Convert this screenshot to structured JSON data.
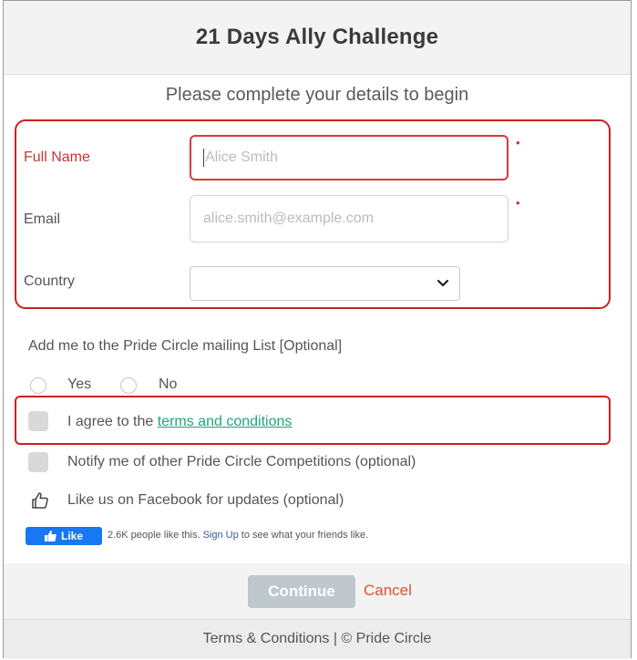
{
  "header": {
    "title": "21 Days Ally Challenge"
  },
  "form": {
    "subtitle": "Please complete your details to begin",
    "full_name": {
      "label": "Full Name",
      "placeholder": "Alice Smith",
      "required_mark": "•"
    },
    "email": {
      "label": "Email",
      "placeholder": "alice.smith@example.com",
      "required_mark": "•"
    },
    "country": {
      "label": "Country",
      "value": ""
    }
  },
  "mailing_list": {
    "question": "Add me to the Pride Circle mailing List [Optional]",
    "options": [
      {
        "label": "Yes"
      },
      {
        "label": "No"
      }
    ]
  },
  "terms": {
    "prefix": "I agree to the ",
    "link_text": "terms and conditions"
  },
  "notify": {
    "label": "Notify me of other Pride Circle Competitions (optional)"
  },
  "facebook": {
    "like_prompt": "Like us on Facebook for updates (optional)",
    "like_button_label": "Like",
    "count_text": "2.6K people like this.",
    "signup_link": "Sign Up",
    "signup_suffix": "to see what your friends like."
  },
  "actions": {
    "continue_label": "Continue",
    "cancel_label": "Cancel"
  },
  "footer": {
    "text": "Terms & Conditions | © Pride Circle"
  },
  "colors": {
    "error_red": "#cc1f1f",
    "link_green": "#1ea57b",
    "facebook_blue": "#1877f2",
    "cancel_orange": "#e2522f",
    "continue_disabled": "#bfc8cc"
  }
}
